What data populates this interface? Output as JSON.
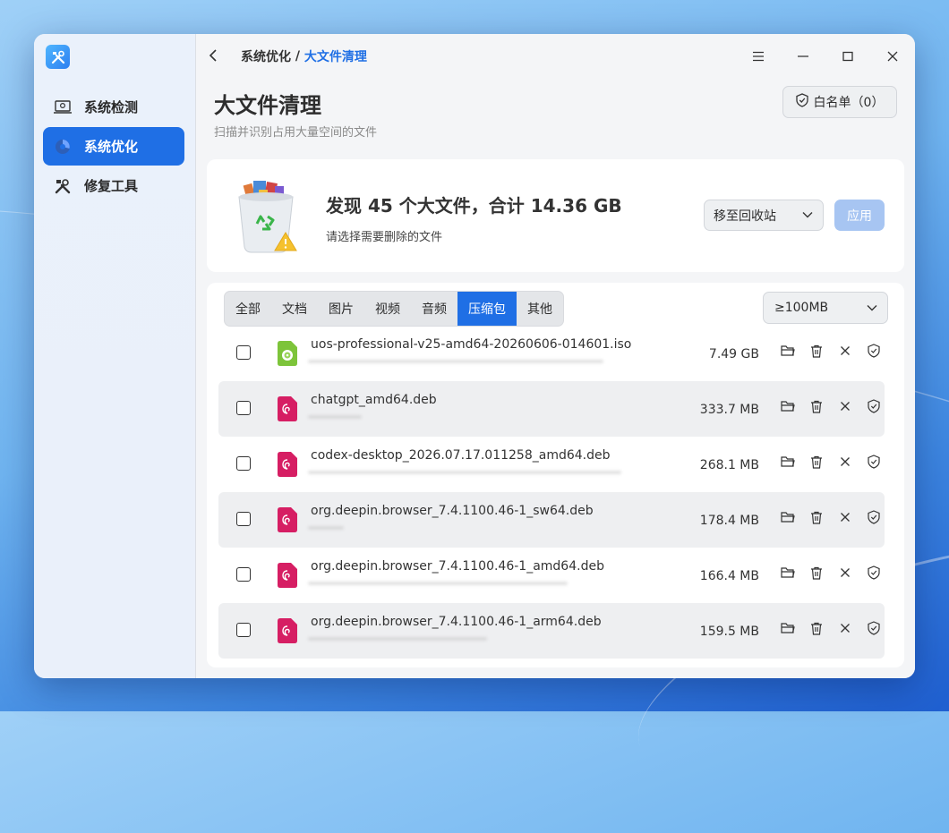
{
  "sidebar": {
    "items": [
      {
        "label": "系统检测",
        "icon": "laptop-search-icon"
      },
      {
        "label": "系统优化",
        "icon": "optimize-icon"
      },
      {
        "label": "修复工具",
        "icon": "tools-icon"
      }
    ]
  },
  "breadcrumb": {
    "parent": "系统优化",
    "separator": " / ",
    "current": "大文件清理"
  },
  "header": {
    "title": "大文件清理",
    "subtitle": "扫描并识别占用大量空间的文件",
    "whitelist_label": "白名单（0）"
  },
  "summary": {
    "title": "发现 45 个大文件，合计 14.36 GB",
    "subtitle": "请选择需要删除的文件",
    "action_selected": "移至回收站",
    "apply_label": "应用"
  },
  "tabs": [
    {
      "label": "全部",
      "active": false
    },
    {
      "label": "文档",
      "active": false
    },
    {
      "label": "图片",
      "active": false
    },
    {
      "label": "视频",
      "active": false
    },
    {
      "label": "音频",
      "active": false
    },
    {
      "label": "压缩包",
      "active": true
    },
    {
      "label": "其他",
      "active": false
    }
  ],
  "size_filter": "≥100MB",
  "files": [
    {
      "name": "uos-professional-v25-amd64-20260606-014601.iso",
      "size": "7.49 GB",
      "type": "iso"
    },
    {
      "name": "chatgpt_amd64.deb",
      "size": "333.7 MB",
      "type": "deb"
    },
    {
      "name": "codex-desktop_2026.07.17.011258_amd64.deb",
      "size": "268.1 MB",
      "type": "deb"
    },
    {
      "name": "org.deepin.browser_7.4.1100.46-1_sw64.deb",
      "size": "178.4 MB",
      "type": "deb"
    },
    {
      "name": "org.deepin.browser_7.4.1100.46-1_amd64.deb",
      "size": "166.4 MB",
      "type": "deb"
    },
    {
      "name": "org.deepin.browser_7.4.1100.46-1_arm64.deb",
      "size": "159.5 MB",
      "type": "deb"
    }
  ],
  "colors": {
    "accent": "#1f6fe5",
    "apply_disabled": "#a7c5f2",
    "deb_icon": "#d61e63",
    "iso_icon": "#7dc43a"
  }
}
